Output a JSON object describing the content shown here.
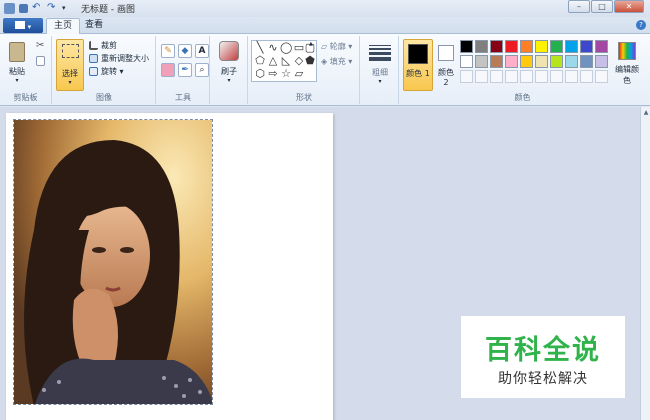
{
  "window": {
    "title": "无标题 - 画图",
    "buttons": {
      "minimize": "–",
      "maximize": "□",
      "close": "✕"
    }
  },
  "tabs": {
    "file": "",
    "home": "主页",
    "view": "查看",
    "help": "?"
  },
  "ribbon": {
    "clipboard": {
      "label": "剪贴板",
      "paste": "粘贴"
    },
    "image": {
      "label": "图像",
      "select": "选择",
      "crop": "裁剪",
      "resize": "重新调整大小",
      "rotate": "旋转"
    },
    "tools": {
      "label": "工具",
      "text_glyph": "A"
    },
    "brushes": {
      "label": "刷子"
    },
    "shapes": {
      "label": "形状",
      "outline": "轮廓",
      "fill": "填充"
    },
    "size": {
      "label": "粗细"
    },
    "colors": {
      "label": "颜色",
      "color1": "颜色 1",
      "color2": "颜色 2",
      "edit": "编辑颜色",
      "color1_value": "#000000",
      "color2_value": "#ffffff",
      "palette_row1": [
        "#000000",
        "#7f7f7f",
        "#880015",
        "#ed1c24",
        "#ff7f27",
        "#fff200",
        "#22b14c",
        "#00a2e8",
        "#3f48cc",
        "#a349a4"
      ],
      "palette_row2": [
        "#ffffff",
        "#c3c3c3",
        "#b97a57",
        "#ffaec9",
        "#ffc90e",
        "#efe4b0",
        "#b5e61d",
        "#99d9ea",
        "#7092be",
        "#c8bfe7"
      ]
    }
  },
  "watermark": {
    "title": "百科全说",
    "subtitle": "助你轻松解决"
  }
}
